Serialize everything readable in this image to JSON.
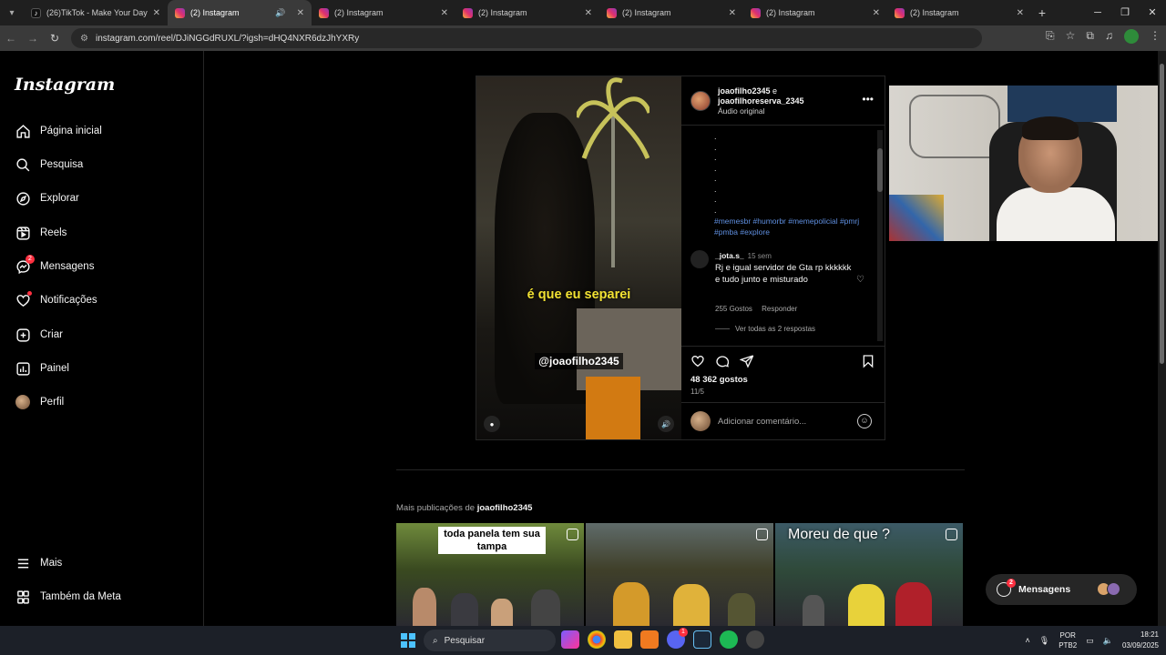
{
  "browser": {
    "tabs": [
      {
        "title": "(26)TikTok - Make Your Day",
        "favicon": "tiktok-icon",
        "active": false
      },
      {
        "title": "(2) Instagram",
        "favicon": "instagram-icon",
        "active": true,
        "audio": true
      },
      {
        "title": "(2) Instagram",
        "favicon": "instagram-icon",
        "active": false
      },
      {
        "title": "(2) Instagram",
        "favicon": "instagram-icon",
        "active": false
      },
      {
        "title": "(2) Instagram",
        "favicon": "instagram-icon",
        "active": false
      },
      {
        "title": "(2) Instagram",
        "favicon": "instagram-icon",
        "active": false
      },
      {
        "title": "(2) Instagram",
        "favicon": "instagram-icon",
        "active": false
      }
    ],
    "url": "instagram.com/reel/DJiNGGdRUXL/?igsh=dHQ4NXR6dzJhYXRy"
  },
  "sidebar": {
    "logo": "Instagram",
    "items": [
      {
        "label": "Página inicial",
        "icon": "home-icon"
      },
      {
        "label": "Pesquisa",
        "icon": "search-icon"
      },
      {
        "label": "Explorar",
        "icon": "compass-icon"
      },
      {
        "label": "Reels",
        "icon": "reels-icon"
      },
      {
        "label": "Mensagens",
        "icon": "messenger-icon",
        "badge": "2"
      },
      {
        "label": "Notificações",
        "icon": "heart-icon",
        "dot": true
      },
      {
        "label": "Criar",
        "icon": "plus-square-icon"
      },
      {
        "label": "Painel",
        "icon": "chart-icon"
      },
      {
        "label": "Perfil",
        "icon": "avatar"
      }
    ],
    "bottom_items": [
      {
        "label": "Mais",
        "icon": "menu-icon"
      },
      {
        "label": "Também da Meta",
        "icon": "meta-icon"
      }
    ]
  },
  "post": {
    "video": {
      "caption_text": "é que eu separei",
      "handle_overlay": "@joaofilho2345"
    },
    "header": {
      "user1": "joaofilho2345",
      "connector": " e",
      "user2": "joaofilhoreserva_2345",
      "audio": "Áudio original"
    },
    "description_dots": [
      ".",
      ".",
      ".",
      ".",
      ".",
      ".",
      ".",
      "."
    ],
    "hashtags": "#memesbr #humorbr #memepolicial #pmrj #pmba #explore",
    "comment": {
      "user": "_jota.s_",
      "time": "15 sem",
      "text": "Rj e igual servidor de Gta rp kkkkkk e tudo junto e misturado",
      "likes": "255 Gostos",
      "reply": "Responder",
      "view_replies": "Ver todas as 2 respostas"
    },
    "likes": "48 362 gostos",
    "date": "11/5",
    "add_comment_placeholder": "Adicionar comentário..."
  },
  "more_posts": {
    "prefix": "Mais publicações de ",
    "user": "joaofilho2345",
    "thumbs": [
      {
        "caption": "toda panela tem sua tampa",
        "style": "boxed"
      },
      {
        "caption": "",
        "style": "none"
      },
      {
        "caption": "Moreu de que ?",
        "style": "plain"
      }
    ]
  },
  "messages_pill": {
    "label": "Mensagens",
    "badge": "2"
  },
  "taskbar": {
    "search_placeholder": "Pesquisar",
    "discord_badge": "1",
    "lang_top": "POR",
    "lang_bottom": "PTB2",
    "time": "18:21",
    "date": "03/09/2025"
  },
  "colors": {
    "hashtag": "#5f8fe0",
    "video_caption": "#f2e233",
    "badge": "#ff3040"
  }
}
